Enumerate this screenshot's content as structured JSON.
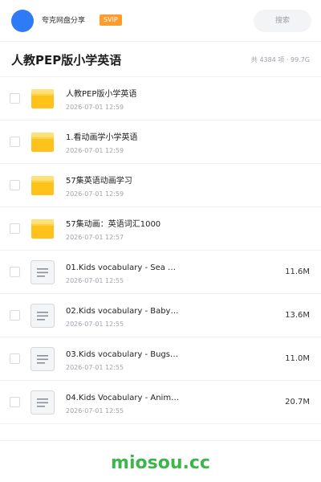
{
  "header": {
    "brand": "夸克网盘分享",
    "badge": "SVIP",
    "search_label": "搜索"
  },
  "folder": {
    "title": "人教PEP版小学英语",
    "stats": "共 4384 项 · 99.7G"
  },
  "items": [
    {
      "type": "folder",
      "icon": "folder-icon",
      "name": "人教PEP版小学英语",
      "date": "2026-07-01 12:59",
      "size": ""
    },
    {
      "type": "folder",
      "icon": "folder-icon",
      "name": "1.看动画学小学英语",
      "date": "2026-07-01 12:59",
      "size": ""
    },
    {
      "type": "folder",
      "icon": "folder-icon",
      "name": "57集英语动画学习",
      "date": "2026-07-01 12:59",
      "size": ""
    },
    {
      "type": "folder",
      "icon": "folder-icon",
      "name": "57集动画：英语词汇1000",
      "date": "2026-07-01 12:57",
      "size": ""
    },
    {
      "type": "file",
      "icon": "document-icon",
      "name": "01.Kids vocabulary - Sea …",
      "date": "2026-07-01 12:55",
      "size": "11.6M"
    },
    {
      "type": "file",
      "icon": "document-icon",
      "name": "02.Kids vocabulary - Baby…",
      "date": "2026-07-01 12:55",
      "size": "13.6M"
    },
    {
      "type": "file",
      "icon": "document-icon",
      "name": "03.Kids vocabulary - Bugs…",
      "date": "2026-07-01 12:55",
      "size": "11.0M"
    },
    {
      "type": "file",
      "icon": "document-icon",
      "name": "04.Kids Vocabulary - Anim…",
      "date": "2026-07-01 12:55",
      "size": "20.7M"
    }
  ],
  "footer": {
    "watermark": "miosou.cc"
  },
  "colors": {
    "avatar": "#2f7bf5",
    "svip_badge": "#ff9c2e",
    "folder": "#ffc21a",
    "watermark": "#3cb64a"
  }
}
